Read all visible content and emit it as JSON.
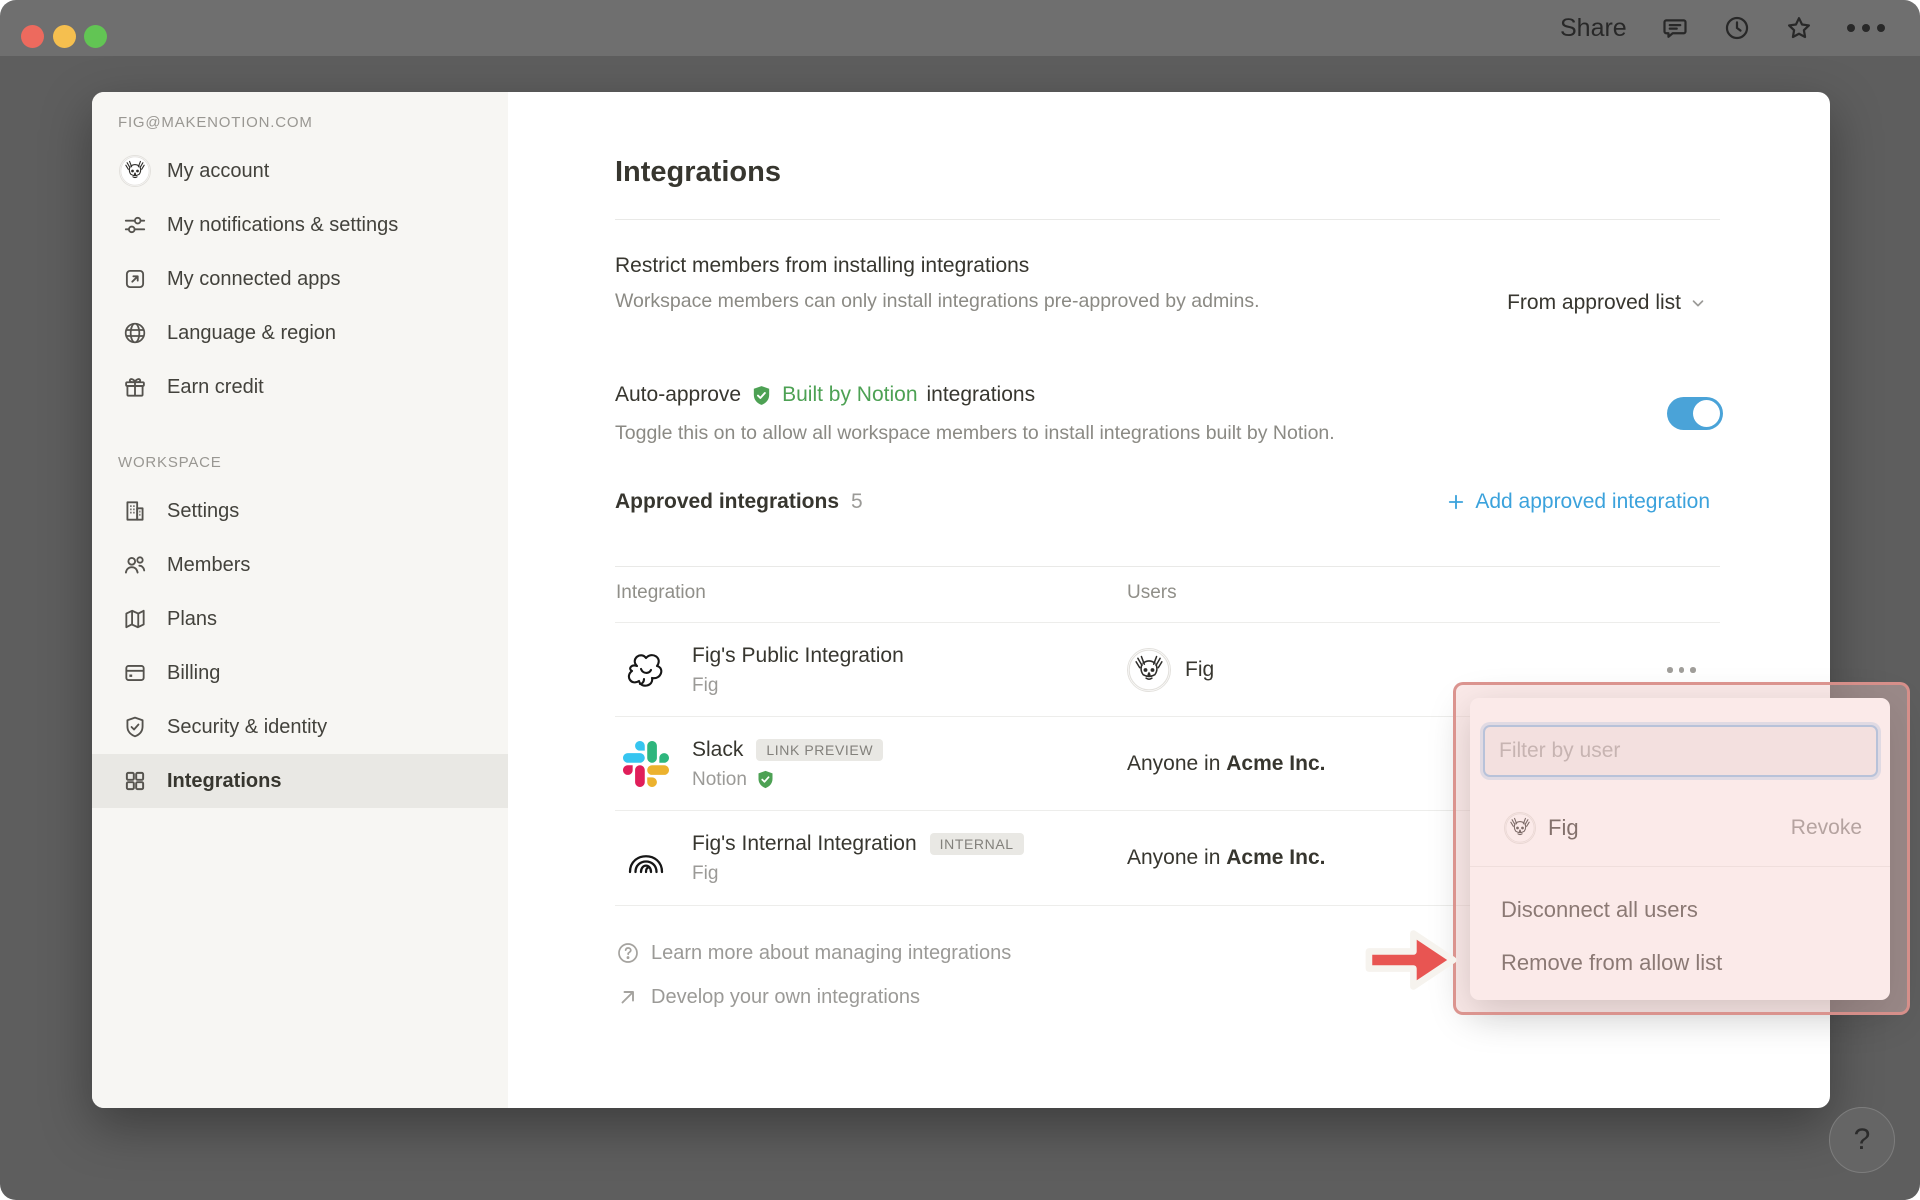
{
  "chrome": {
    "share_label": "Share",
    "icons": [
      "comment-icon",
      "clock-icon",
      "star-icon",
      "ellipsis-icon"
    ]
  },
  "sidebar": {
    "account_email": "FIG@MAKENOTION.COM",
    "account_items": [
      {
        "label": "My account",
        "icon": "dog-avatar"
      },
      {
        "label": "My notifications & settings",
        "icon": "sliders-icon"
      },
      {
        "label": "My connected apps",
        "icon": "external-link-icon"
      },
      {
        "label": "Language & region",
        "icon": "globe-icon"
      },
      {
        "label": "Earn credit",
        "icon": "gift-icon"
      }
    ],
    "workspace_label": "WORKSPACE",
    "workspace_items": [
      {
        "label": "Settings",
        "icon": "building-icon"
      },
      {
        "label": "Members",
        "icon": "people-icon"
      },
      {
        "label": "Plans",
        "icon": "map-icon"
      },
      {
        "label": "Billing",
        "icon": "credit-card-icon"
      },
      {
        "label": "Security & identity",
        "icon": "shield-icon"
      },
      {
        "label": "Integrations",
        "icon": "grid-icon",
        "selected": true
      }
    ]
  },
  "main": {
    "title": "Integrations",
    "restrict": {
      "heading": "Restrict members from installing integrations",
      "description": "Workspace members can only install integrations pre-approved by admins.",
      "value": "From approved list"
    },
    "auto_approve": {
      "prefix": "Auto-approve",
      "badge_label": "Built by Notion",
      "suffix": "integrations",
      "description": "Toggle this on to allow all workspace members to install integrations built by Notion.",
      "toggle_state": "on"
    },
    "approved": {
      "heading": "Approved integrations",
      "count": "5",
      "add_label": "Add approved integration"
    },
    "table": {
      "columns": [
        "Integration",
        "Users"
      ],
      "rows": [
        {
          "name": "Fig's Public Integration",
          "subtitle": "Fig",
          "badge": "",
          "icon": "scribble-doodle-icon",
          "user": "Fig",
          "user_avatar": "dog-avatar"
        },
        {
          "name": "Slack",
          "subtitle": "Notion",
          "badge": "LINK PREVIEW",
          "icon": "slack-logo",
          "verified": true,
          "users_prefix": "Anyone in",
          "users_org": "Acme Inc."
        },
        {
          "name": "Fig's Internal Integration",
          "subtitle": "Fig",
          "badge": "INTERNAL",
          "icon": "arches-doodle-icon",
          "users_prefix": "Anyone in",
          "users_org": "Acme Inc."
        }
      ]
    },
    "footer_links": [
      {
        "label": "Learn more about managing integrations",
        "icon": "question-circle-icon"
      },
      {
        "label": "Develop your own integrations",
        "icon": "arrow-up-right-icon"
      }
    ]
  },
  "popup": {
    "filter_placeholder": "Filter by user",
    "user_row": {
      "name": "Fig",
      "action": "Revoke",
      "avatar": "dog-avatar"
    },
    "menu_items": [
      "Disconnect all users",
      "Remove from allow list"
    ],
    "annotation": {
      "shape": "red-arrow-and-box",
      "color": "#d98f8a"
    }
  },
  "help": {
    "label": "?"
  },
  "colors": {
    "accent_blue": "#3ba2dc",
    "toggle_blue": "#4aa3d8",
    "verified_green": "#4da154",
    "annotation_red": "#e85552",
    "sidebar_bg": "#f7f6f3",
    "backdrop_gray": "#5e5e5e"
  }
}
